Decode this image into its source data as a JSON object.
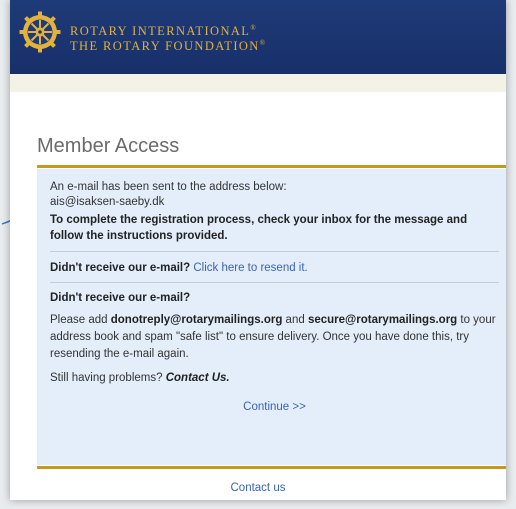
{
  "brand": {
    "line1": "ROTARY INTERNATIONAL",
    "line2": "THE ROTARY FOUNDATION",
    "mark": "®"
  },
  "page": {
    "title": "Member Access"
  },
  "notice": {
    "sent_text": "An e-mail has been sent to the address below:",
    "email": "ais@isaksen-saeby.dk",
    "instructions": "To complete the registration process, check your inbox for the message and follow the instructions provided."
  },
  "resend": {
    "question": "Didn't receive our e-mail?",
    "link": "Click here to resend it."
  },
  "help": {
    "heading": "Didn't receive our e-mail?",
    "text_pre": "Please add ",
    "address1": "donotreply@rotarymailings.org",
    "text_and": " and ",
    "address2": "secure@rotarymailings.org",
    "text_post": " to your address book and spam \"safe list\" to ensure delivery. Once you have done this, try resending the e-mail again.",
    "problems": "Still having problems?",
    "contact": "Contact Us."
  },
  "continue_label": "Continue >>",
  "footer": {
    "contact_label": "Contact us"
  },
  "colors": {
    "header": "#1f3a78",
    "gold": "#c49a1d",
    "panel": "#e4eefa",
    "link": "#3a63b8"
  }
}
